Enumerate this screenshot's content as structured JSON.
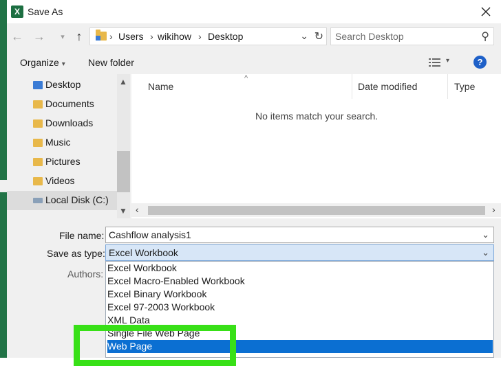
{
  "window": {
    "title": "Save As",
    "app_icon": "X"
  },
  "address": {
    "crumbs": [
      "Users",
      "wikihow",
      "Desktop"
    ]
  },
  "search": {
    "placeholder": "Search Desktop"
  },
  "toolbar": {
    "organize": "Organize",
    "new_folder": "New folder"
  },
  "nav": {
    "items": [
      "Desktop",
      "Documents",
      "Downloads",
      "Music",
      "Pictures",
      "Videos",
      "Local Disk (C:)"
    ]
  },
  "files": {
    "columns": [
      "Name",
      "Date modified",
      "Type"
    ],
    "empty_message": "No items match your search."
  },
  "form": {
    "file_name_label": "File name:",
    "file_name_value": "Cashflow analysis1",
    "save_as_type_label": "Save as type:",
    "save_as_type_value": "Excel Workbook",
    "authors_label": "Authors:"
  },
  "type_options": [
    "Excel Workbook",
    "Excel Macro-Enabled Workbook",
    "Excel Binary Workbook",
    "Excel 97-2003 Workbook",
    "XML Data",
    "Single File Web Page",
    "Web Page"
  ],
  "colors": {
    "excel_green": "#217346",
    "highlight": "#0b6fd2",
    "callout": "#38e017"
  }
}
